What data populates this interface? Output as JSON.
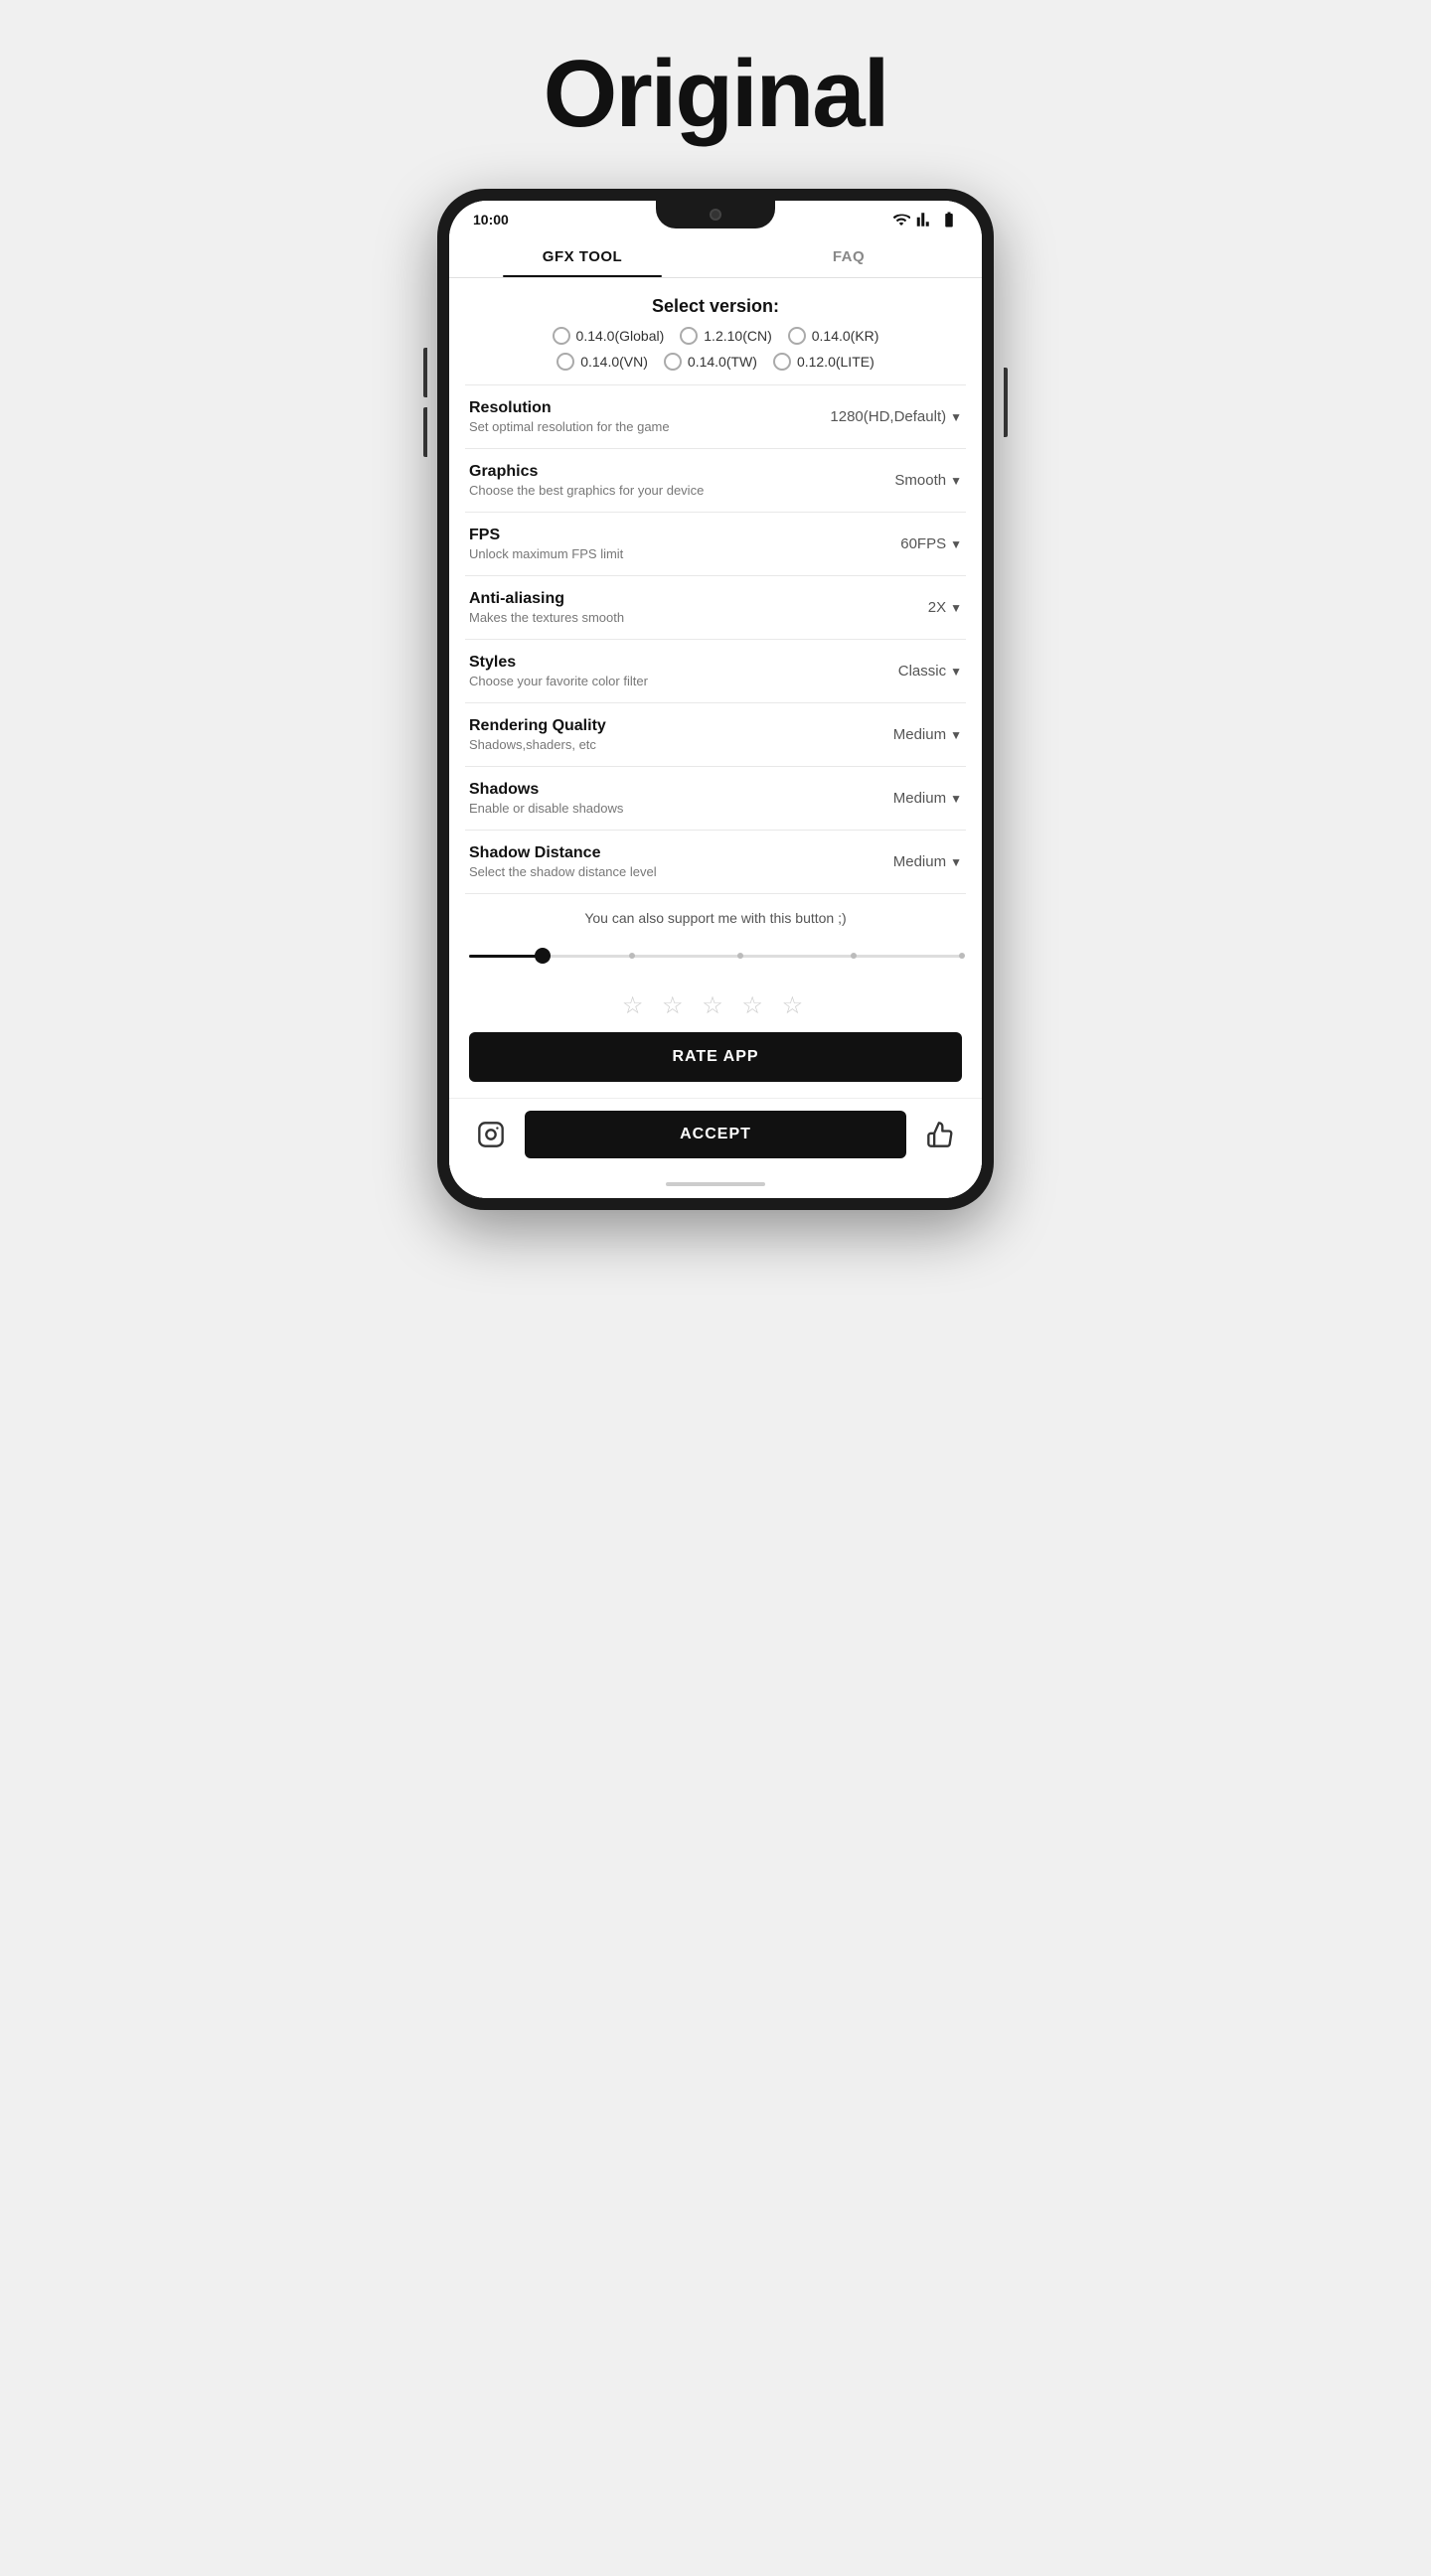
{
  "page": {
    "title": "Original"
  },
  "status_bar": {
    "time": "10:00"
  },
  "tabs": [
    {
      "id": "gfx-tool",
      "label": "GFX TOOL",
      "active": true
    },
    {
      "id": "faq",
      "label": "FAQ",
      "active": false
    }
  ],
  "version_selector": {
    "title": "Select version:",
    "options": [
      {
        "id": "global",
        "label": "0.14.0(Global)"
      },
      {
        "id": "cn",
        "label": "1.2.10(CN)"
      },
      {
        "id": "kr",
        "label": "0.14.0(KR)"
      },
      {
        "id": "vn",
        "label": "0.14.0(VN)"
      },
      {
        "id": "tw",
        "label": "0.14.0(TW)"
      },
      {
        "id": "lite",
        "label": "0.12.0(LITE)"
      }
    ]
  },
  "settings": [
    {
      "id": "resolution",
      "label": "Resolution",
      "description": "Set optimal resolution for the game",
      "value": "1280(HD,Default)"
    },
    {
      "id": "graphics",
      "label": "Graphics",
      "description": "Choose the best graphics for your device",
      "value": "Smooth"
    },
    {
      "id": "fps",
      "label": "FPS",
      "description": "Unlock maximum FPS limit",
      "value": "60FPS"
    },
    {
      "id": "anti-aliasing",
      "label": "Anti-aliasing",
      "description": "Makes the textures smooth",
      "value": "2X"
    },
    {
      "id": "styles",
      "label": "Styles",
      "description": "Choose your favorite color filter",
      "value": "Classic"
    },
    {
      "id": "rendering-quality",
      "label": "Rendering Quality",
      "description": "Shadows,shaders, etc",
      "value": "Medium"
    },
    {
      "id": "shadows",
      "label": "Shadows",
      "description": "Enable or disable shadows",
      "value": "Medium"
    },
    {
      "id": "shadow-distance",
      "label": "Shadow Distance",
      "description": "Select the shadow distance level",
      "value": "Medium"
    }
  ],
  "support": {
    "text": "You can also support me with this button ;)",
    "stars_label": "★★★★★",
    "rate_app_label": "RATE APP"
  },
  "bottom_bar": {
    "accept_label": "ACCEPT",
    "instagram_icon": "instagram",
    "thumbsup_icon": "thumbs-up"
  }
}
